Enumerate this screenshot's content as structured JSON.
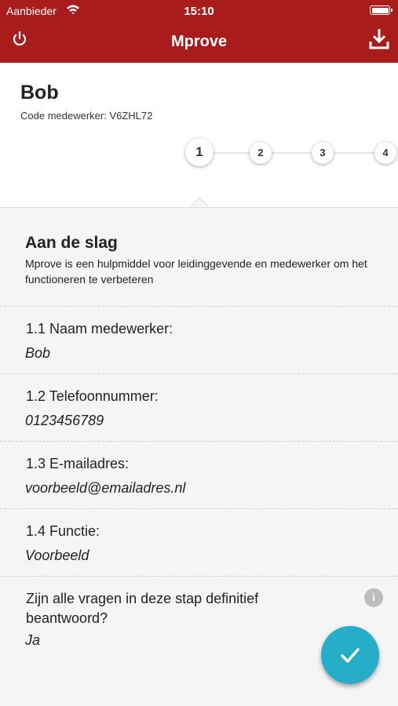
{
  "status_bar": {
    "carrier": "Aanbieder",
    "time": "15:10"
  },
  "nav": {
    "title": "Mprove",
    "left_icon": "power-icon",
    "right_icon": "download-icon"
  },
  "header": {
    "name": "Bob",
    "code_line": "Code medewerker: V6ZHL72",
    "steps": [
      "1",
      "2",
      "3",
      "4"
    ],
    "active_step": "1"
  },
  "intro": {
    "title": "Aan de slag",
    "text": "Mprove is een hulpmiddel voor leidinggevende en medewerker om het functioneren te verbeteren"
  },
  "questions": [
    {
      "label": "1.1 Naam medewerker:",
      "value": "Bob"
    },
    {
      "label": "1.2 Telefoonnummer:",
      "value": "0123456789"
    },
    {
      "label": "1.3 E-mailadres:",
      "value": "voorbeeld@emailadres.nl"
    },
    {
      "label": "1.4 Functie:",
      "value": "Voorbeeld"
    }
  ],
  "final_question": {
    "label": "Zijn alle vragen in deze stap definitief beantwoord?",
    "value": "Ja",
    "info_icon_text": "i"
  },
  "fab": {
    "icon": "check-icon"
  },
  "colors": {
    "brand": "#a81c1c",
    "accent": "#26aec8"
  }
}
